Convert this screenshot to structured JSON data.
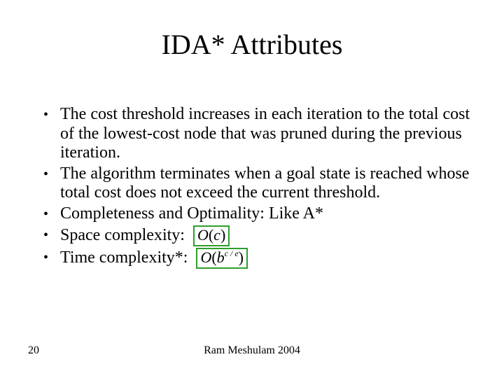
{
  "title": "IDA* Attributes",
  "bullets": [
    "The cost threshold increases in each iteration to the total cost of the lowest-cost node that was pruned during the previous iteration.",
    " The algorithm terminates when a goal state is reached whose total cost does not exceed the current threshold.",
    "Completeness and Optimality: Like A*",
    "Space complexity: ",
    "Time complexity*: "
  ],
  "formulas": {
    "space": {
      "func": "O",
      "open": "(",
      "arg": "c",
      "close": ")"
    },
    "time": {
      "func": "O",
      "open": "(",
      "base": "b",
      "exp": "c / e",
      "close": ")"
    }
  },
  "page_number": "20",
  "footer": "Ram Meshulam 2004"
}
